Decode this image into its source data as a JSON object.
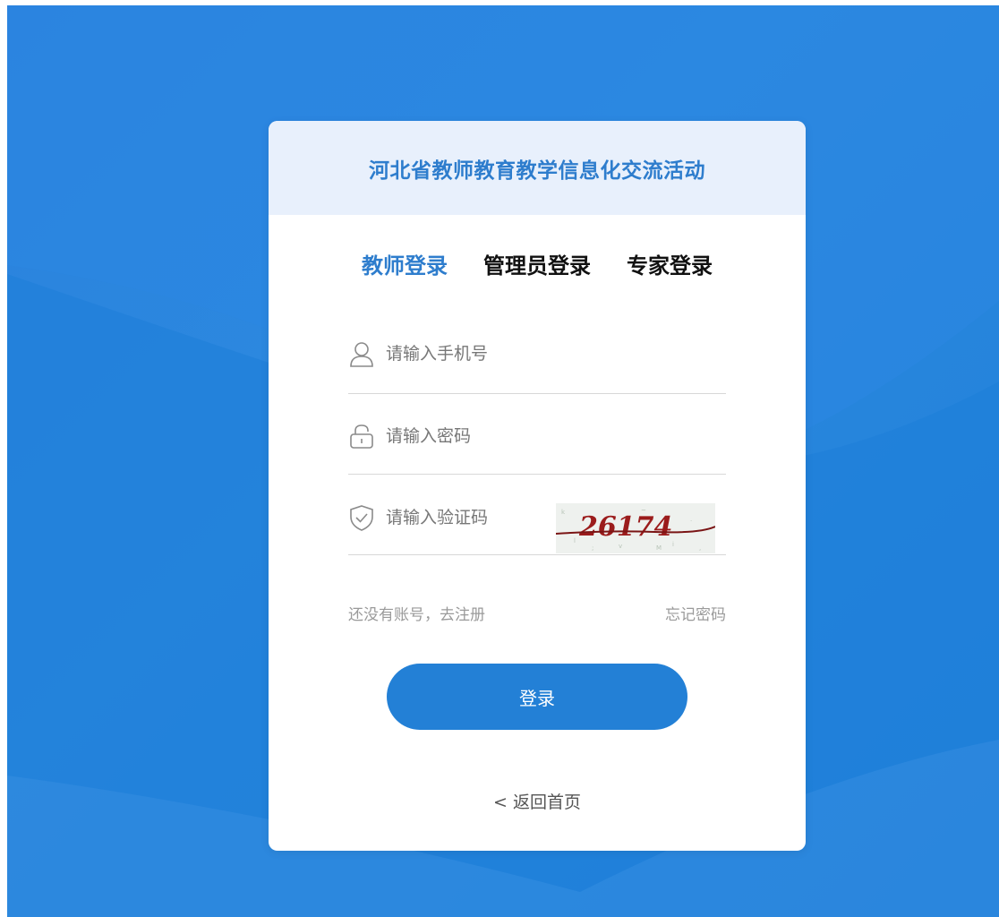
{
  "theme": {
    "accent": "#2e7dcd",
    "button": "#2380d6",
    "background": "#2a82de",
    "header_bg": "#e8f0fc"
  },
  "card": {
    "title": "河北省教师教育教学信息化交流活动"
  },
  "tabs": [
    {
      "label": "教师登录",
      "active": true
    },
    {
      "label": "管理员登录",
      "active": false
    },
    {
      "label": "专家登录",
      "active": false
    }
  ],
  "form": {
    "phone": {
      "placeholder": "请输入手机号",
      "value": "",
      "icon": "user-icon"
    },
    "password": {
      "placeholder": "请输入密码",
      "value": "",
      "icon": "lock-icon"
    },
    "captcha": {
      "placeholder": "请输入验证码",
      "value": "",
      "icon": "shield-check-icon",
      "image_text": "26174"
    }
  },
  "links": {
    "register": "还没有账号，去注册",
    "forgot": "忘记密码"
  },
  "login_button": "登录",
  "back_home": "< 返回首页"
}
